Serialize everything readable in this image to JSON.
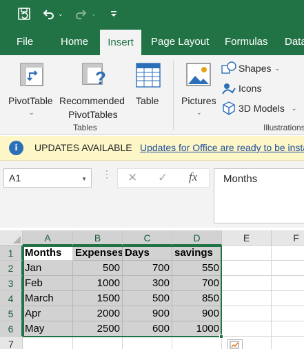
{
  "quick_access": {
    "autosave_icon": "autosave-icon",
    "undo_icon": "undo-icon",
    "redo_icon": "redo-icon",
    "customize_icon": "customize-qat-icon"
  },
  "tabs": [
    {
      "label": "File"
    },
    {
      "label": "Home"
    },
    {
      "label": "Insert"
    },
    {
      "label": "Page Layout"
    },
    {
      "label": "Formulas"
    },
    {
      "label": "Data"
    }
  ],
  "ribbon": {
    "pivottable": "PivotTable",
    "recommended_line1": "Recommended",
    "recommended_line2": "PivotTables",
    "table": "Table",
    "tables_group": "Tables",
    "pictures": "Pictures",
    "shapes": "Shapes",
    "icons": "Icons",
    "models": "3D Models",
    "illustrations_group": "Illustrations"
  },
  "message_bar": {
    "title": "UPDATES AVAILABLE",
    "link": "Updates for Office are ready to be installed"
  },
  "formula_bar": {
    "name_box": "A1",
    "formula": "Months",
    "fx": "fx"
  },
  "grid": {
    "columns": [
      "A",
      "B",
      "C",
      "D",
      "E",
      "F"
    ],
    "rows": [
      "1",
      "2",
      "3",
      "4",
      "5",
      "6",
      "7"
    ],
    "data": [
      [
        "Months",
        "Expenses",
        "Days",
        "savings"
      ],
      [
        "Jan",
        "500",
        "700",
        "550"
      ],
      [
        "Feb",
        "1000",
        "300",
        "700"
      ],
      [
        "March",
        "1500",
        "500",
        "850"
      ],
      [
        "Apr",
        "2000",
        "900",
        "900"
      ],
      [
        "May",
        "2500",
        "600",
        "1000"
      ]
    ]
  },
  "colors": {
    "excel_green": "#217346",
    "selection_fill": "#d2d2d2",
    "message_bar": "#fdf6c7"
  }
}
